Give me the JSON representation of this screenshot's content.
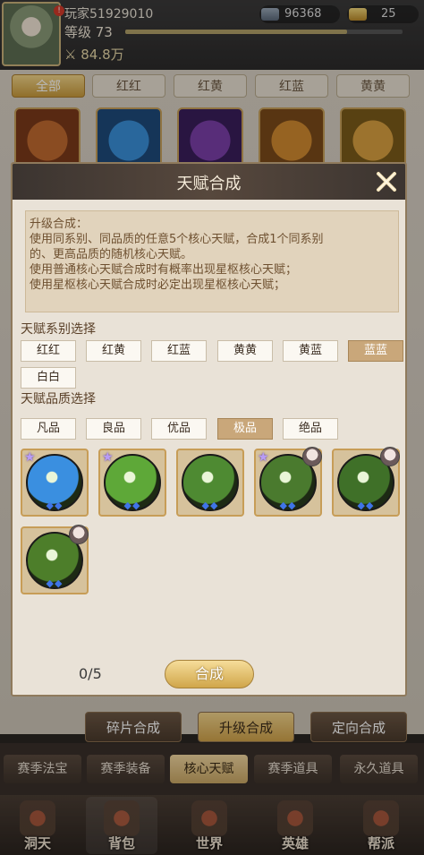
{
  "player": {
    "name": "玩家51929010",
    "level": "等级 73",
    "exp_progress": 0.8,
    "power": "84.8万",
    "silver": "96368",
    "gold": "25"
  },
  "filter_tabs": [
    "全部",
    "红红",
    "红黄",
    "红蓝",
    "黄黄"
  ],
  "action_tabs": [
    "碎片合成",
    "升级合成",
    "定向合成"
  ],
  "category_tabs": [
    "赛季法宝",
    "赛季装备",
    "核心天赋",
    "赛季道具",
    "永久道具"
  ],
  "nav": [
    "洞天",
    "背包",
    "世界",
    "英雄",
    "帮派"
  ],
  "modal": {
    "title": "天赋合成",
    "description": [
      "升级合成：",
      "使用同系别、同品质的任意5个核心天赋，合成1个同系别",
      "的、更高品质的随机核心天赋。",
      "使用普通核心天赋合成时有概率出现星枢核心天赋；",
      "使用星枢核心天赋合成时必定出现星枢核心天赋；"
    ],
    "series_label": "天赋系别选择",
    "series": [
      "红红",
      "红黄",
      "红蓝",
      "黄黄",
      "黄蓝",
      "蓝蓝",
      "白白"
    ],
    "selected_series": "蓝蓝",
    "quality_label": "天赋品质选择",
    "qualities": [
      "凡品",
      "良品",
      "优品",
      "极品",
      "绝品"
    ],
    "selected_quality": "极品",
    "talents": [
      {
        "color": "#3a8fe0",
        "star": true,
        "hero": false
      },
      {
        "color": "#5ea838",
        "star": true,
        "hero": false
      },
      {
        "color": "#4e8a32",
        "star": false,
        "hero": false
      },
      {
        "color": "#4a7a2e",
        "star": true,
        "hero": true
      },
      {
        "color": "#3f7028",
        "star": false,
        "hero": true
      },
      {
        "color": "#4d7e2a",
        "star": false,
        "hero": true
      }
    ],
    "count": "0/5",
    "merge_label": "合成"
  },
  "colors": {
    "gold": "#d0a64a",
    "header": "#3b3430",
    "panel": "#e9e2d7"
  }
}
